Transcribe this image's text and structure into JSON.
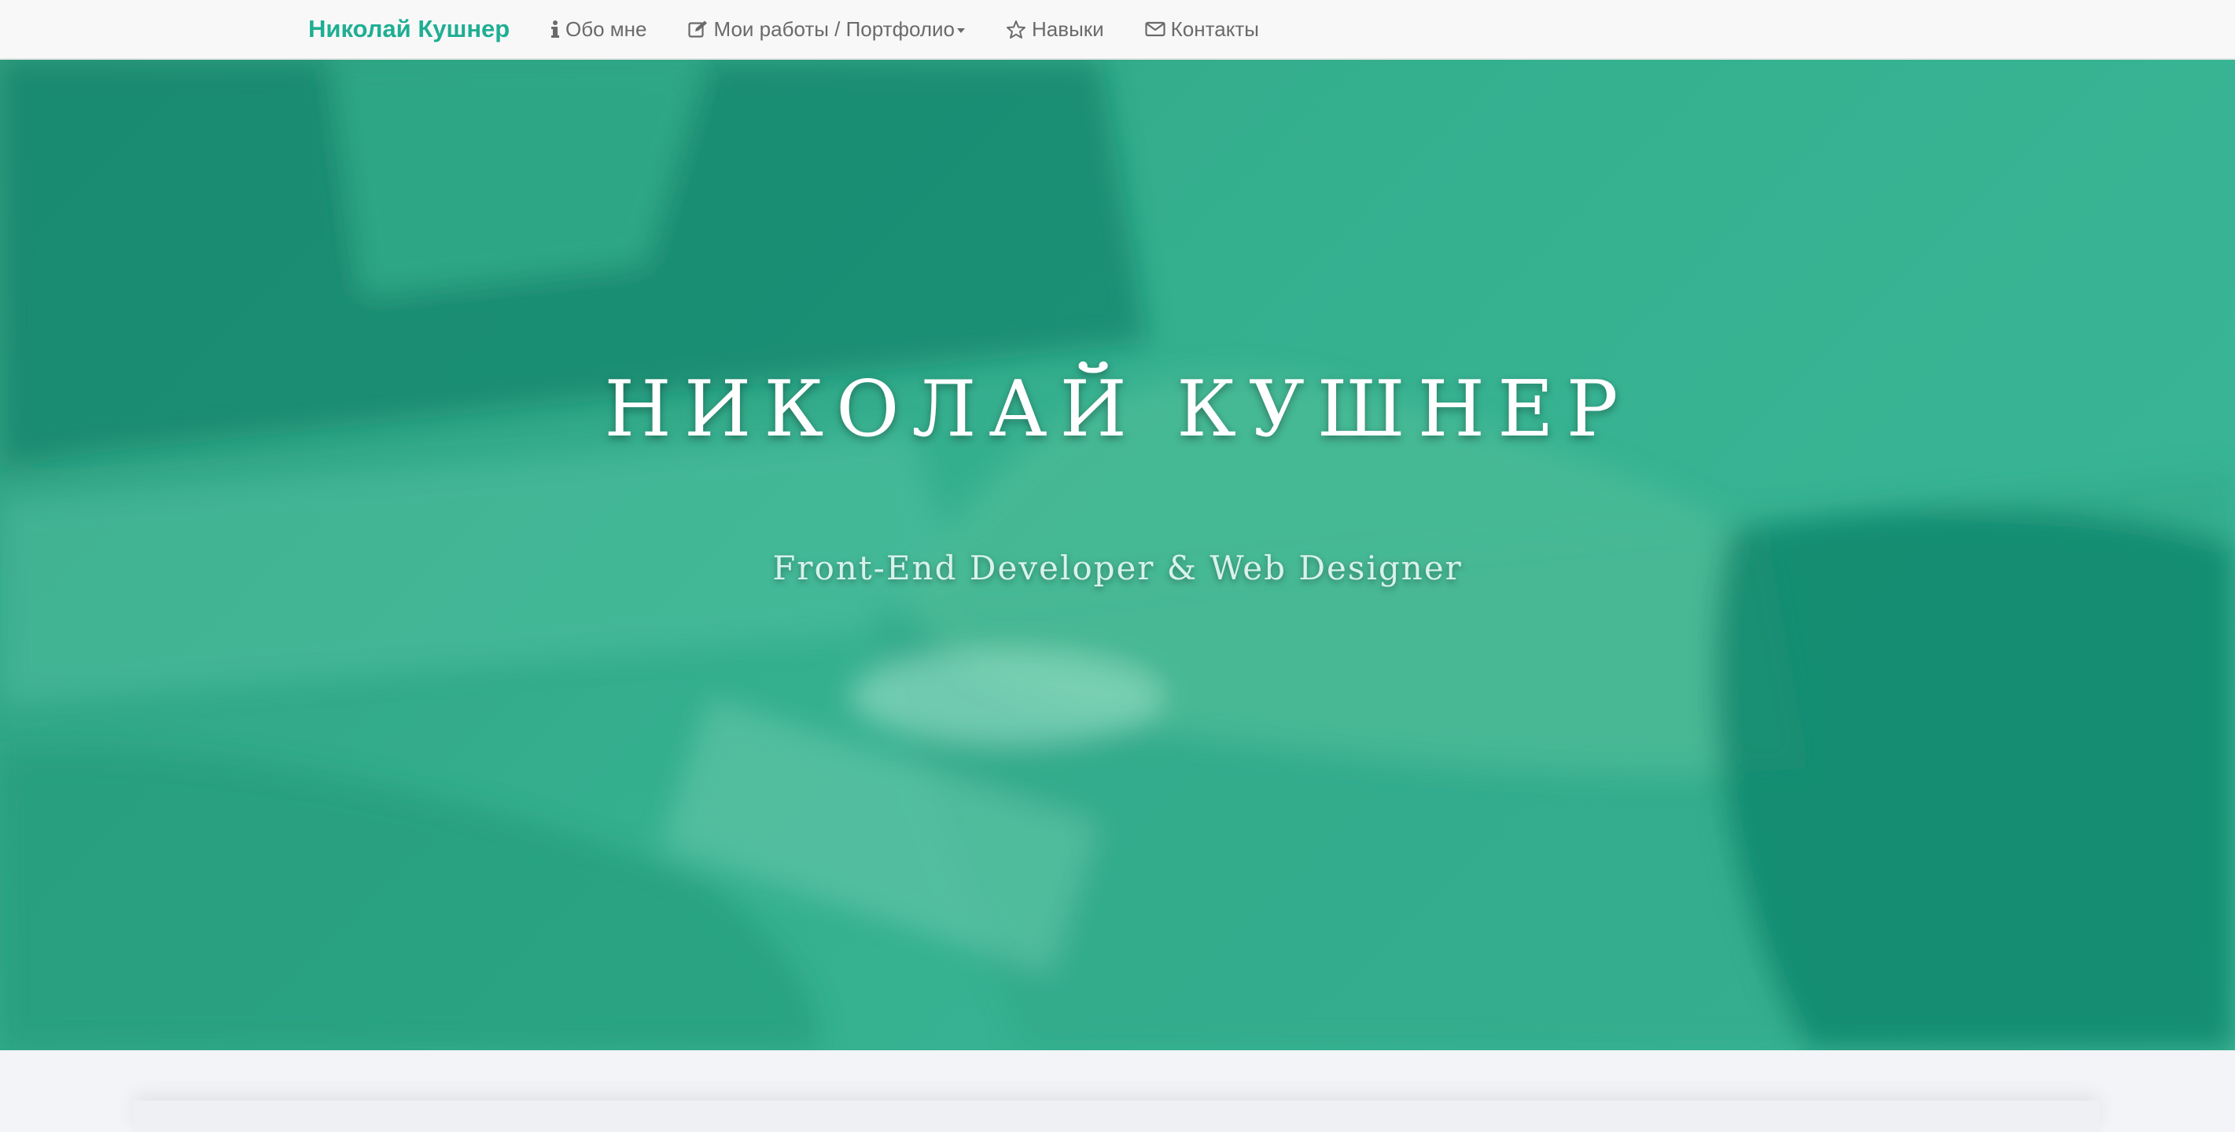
{
  "navbar": {
    "brand": "Николай Кушнер",
    "items": [
      {
        "label": "Обо мне",
        "icon": "info-icon"
      },
      {
        "label": "Мои работы / Портфолио",
        "icon": "edit-icon",
        "dropdown": true
      },
      {
        "label": "Навыки",
        "icon": "star-icon"
      },
      {
        "label": "Контакты",
        "icon": "envelope-icon"
      }
    ]
  },
  "hero": {
    "title": "НИКОЛАЙ КУШНЕР",
    "subtitle": "Front-End Developer & Web Designer",
    "overlay_color": "#2fa080"
  },
  "colors": {
    "brand": "#1fae93",
    "nav_text": "#6a6a6a",
    "navbar_bg": "#f8f8f8",
    "page_bg": "#f2f4f7"
  }
}
